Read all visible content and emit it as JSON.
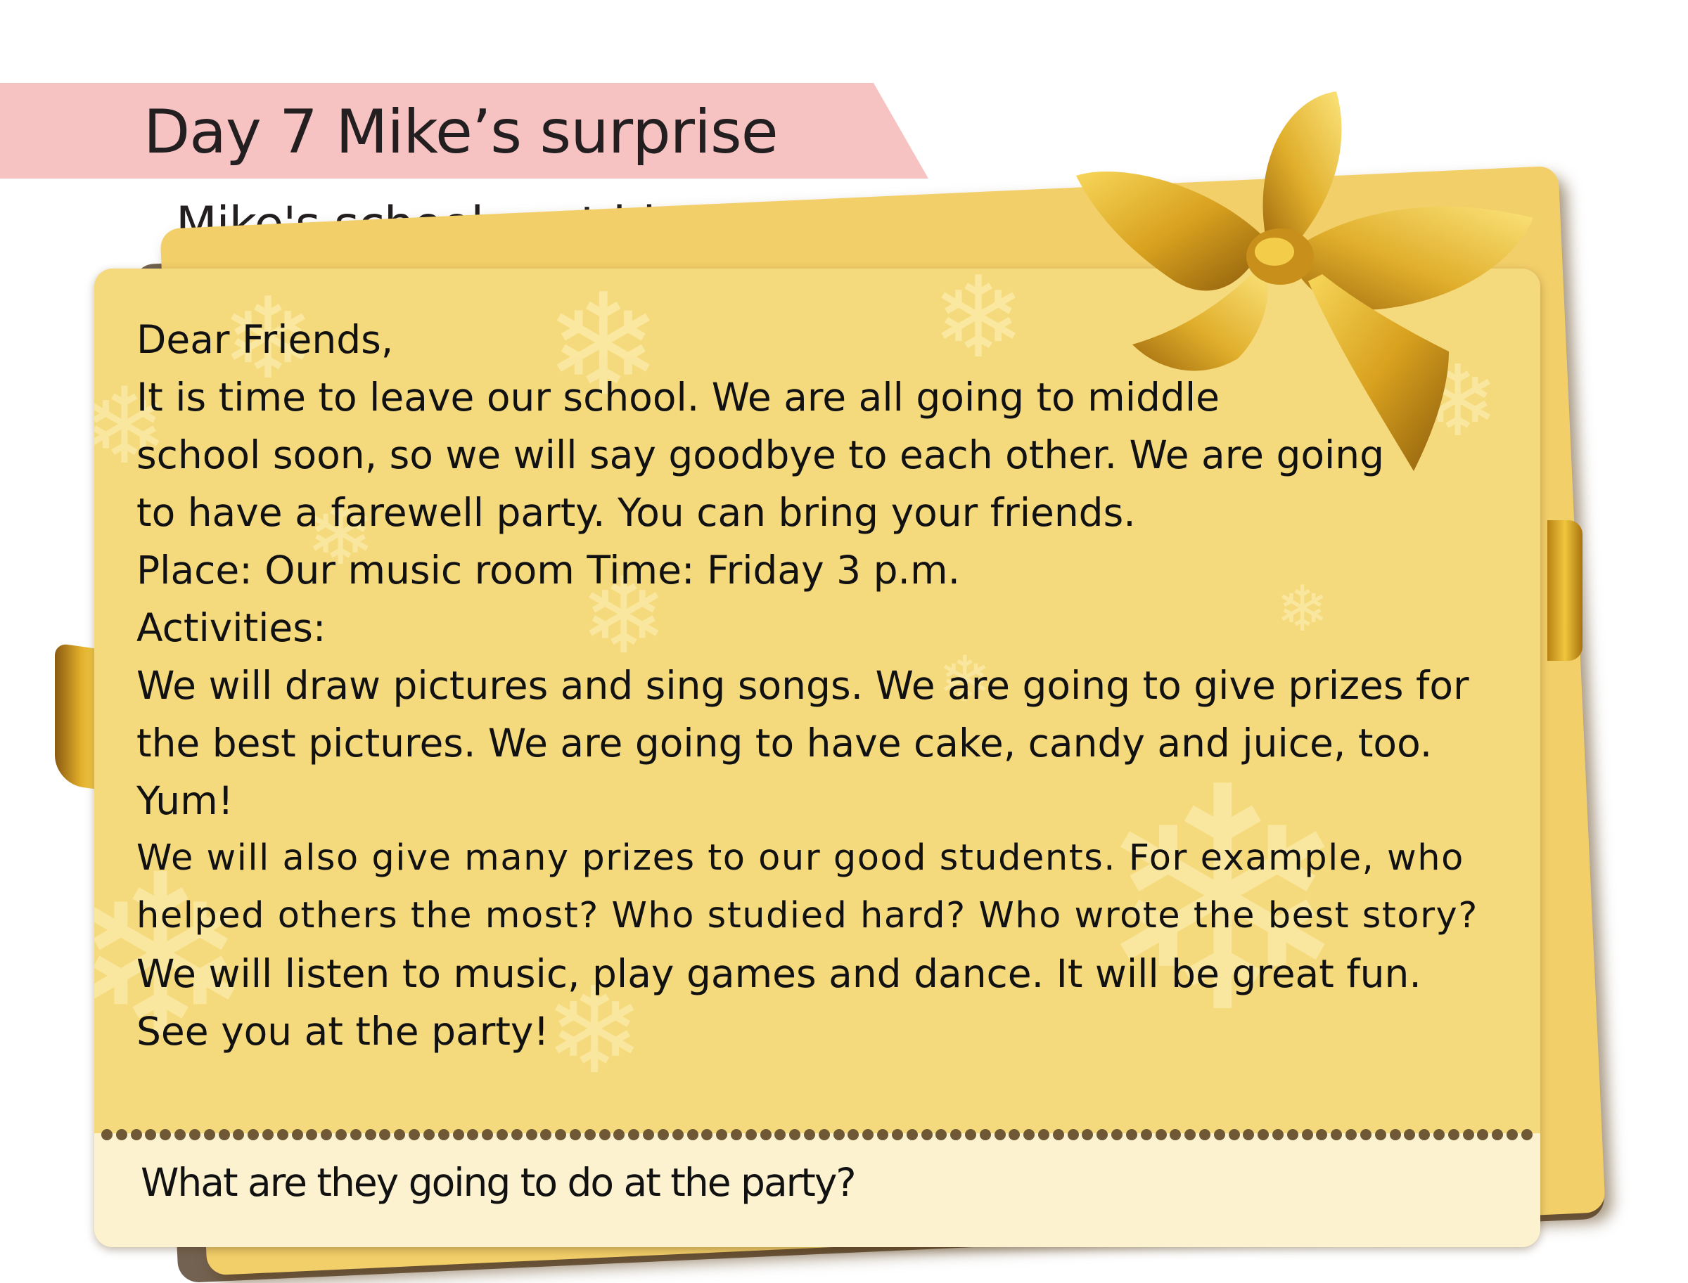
{
  "header": {
    "title": "Day 7  Mike’s surprise",
    "subtitle": "Mike's school sent him an invitation."
  },
  "letter": {
    "greeting": "Dear Friends,",
    "paragraph1_line1": "It is time to leave our school. We are all going to middle",
    "paragraph1_line2": "school soon, so we will say goodbye to each other. We are going",
    "paragraph1_line3": "to have a farewell party. You can bring your friends.",
    "place_time": "Place: Our music room  Time: Friday 3 p.m.",
    "activities_heading": "Activities:",
    "activities_line1": "We will draw pictures and sing songs. We are going to give prizes for",
    "activities_line2": "the best pictures. We are going to have cake, candy and juice, too.",
    "activities_line3": "Yum!",
    "prizes_line1": "We will also give many prizes to our good students. For example, who",
    "prizes_line2": "helped others the most? Who studied hard? Who wrote the best story?",
    "fun_line": "We will listen to music, play games and dance. It will be great fun.",
    "closing": "See you at the party!"
  },
  "footer": {
    "question": "What are they going to do at the party?"
  },
  "colors": {
    "banner": "#f6c3c2",
    "card": "#f5da7d",
    "card_footer": "#fcf2d0",
    "ribbon_gold": "#e0ad2a",
    "dots": "#6e5836"
  },
  "decorations": {
    "bow": "gold-bow-icon",
    "snowflakes": "snowflake-icon"
  }
}
